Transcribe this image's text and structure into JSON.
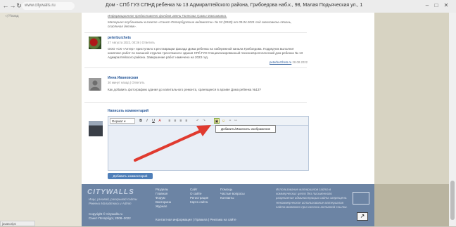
{
  "browser": {
    "url": "www.citywalls.ru",
    "page_heading": "Дом - СПб ГУЗ СПНД ребенка № 13 Адмиралтейского района, Грибоедова наб.к., 98, Малая Подьяческая ул., 1",
    "status_text": "javascript:"
  },
  "sidebar": {
    "back_label": "Назад"
  },
  "comments": {
    "top_text_1": "Информационное предоставлено фондом имени Полесова Грамы Максимовна.",
    "top_text_2": "Материал опубликован в газете «Санкт-Петербургские ведомости» № 52 (9930) от 09.04.2021 под заголовком «Жизнь, спасённая детям».",
    "items": [
      {
        "author": "peterburzhets",
        "meta": "27 Августа 2022, 00:36 | Ответить",
        "text": "ООО «СК «Антер» приступило к реставрации фасада Дома ребенка на набережной канала Грибоедова. Подрядчик выполнит комплекс работ по внешней отделке трехэтажного здания СПб ГУЗ Специализированный психоневрологический дом ребенка № 13 Адмиралтейского района. Завершение работ намечено на 2023 год.",
        "source": "peterburzhets.ru",
        "source_date": "28.08.2022"
      },
      {
        "author": "Инна Ивановская",
        "meta": "30 минут назад | Ответить",
        "text": "Как добавить фотографию здания до капитального ремонта, хранящиеся в архиве Дома ребенка №13?"
      }
    ]
  },
  "editor": {
    "heading": "Написать комментарий",
    "format": "Формат",
    "toolbar": [
      "B",
      "I",
      "U",
      "A",
      "≡",
      "≡",
      "≡",
      "≡",
      "↶",
      "↷",
      "▣",
      "☺",
      "⚭",
      "⚯"
    ],
    "tooltip": "Добавить/Изменить изображение",
    "submit_label": "Добавить комментарий"
  },
  "footer": {
    "logo": "CITYWALLS",
    "tagline_1": "Ищи, узнавай, раскрывай сайты",
    "tagline_2": "Ремени Малайтюка и Admin",
    "copyright": "Copyright © Citywalls.ru",
    "years": "Санкт-Петербург, 2008–2022",
    "col1": [
      "Разделы",
      "Главная",
      "Форум",
      "Викторина",
      "Журнал"
    ],
    "col2": [
      "Сайт",
      "О сайте",
      "Регистрация",
      "Карта сайта"
    ],
    "col3": [
      "Помощь",
      "Частые вопросы",
      "Контакты"
    ],
    "bottom_links": "Контактная информация | Правила | Реклама на сайте",
    "note_1": "Использование материалов сайта в коммерческих целях без письменного разрешения администрации сайта запрещено.",
    "note_2": "Некоммерческое использование материалов сайта возможно при наличии активной ссылки."
  },
  "colors": {
    "accent": "#4f7fb9",
    "annotation": "#e03a2f",
    "footer": "#6c84a4"
  },
  "icons": [
    "back-arrow-icon",
    "forward-arrow-icon",
    "reload-icon",
    "image-icon",
    "smiley-icon",
    "share-icon"
  ]
}
